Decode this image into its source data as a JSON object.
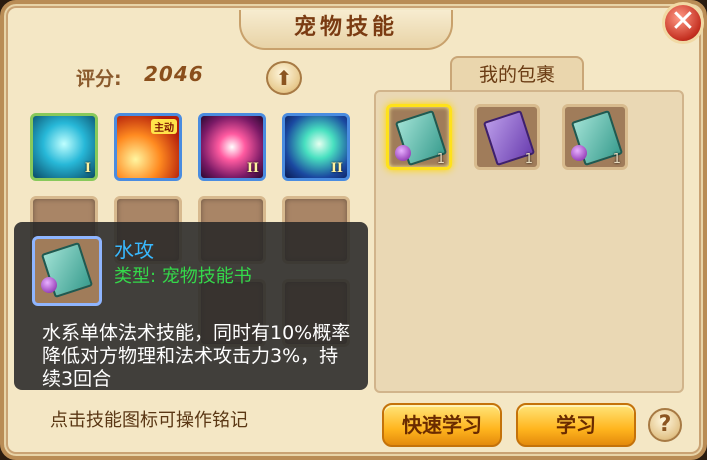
{
  "window": {
    "title": "宠物技能",
    "close_glyph": "✕"
  },
  "score": {
    "label": "评分:",
    "value": "2046"
  },
  "upgrade": {
    "icon": "up-arrow-icon",
    "glyph": "⬆"
  },
  "skills": [
    {
      "name": "water-ghost-skill",
      "level": "I",
      "color": "#27b8d8"
    },
    {
      "name": "fire-burst-skill",
      "badge": "主动",
      "color": "#ff8a20"
    },
    {
      "name": "crimson-star-skill",
      "level": "II",
      "color": "#ff5aa0"
    },
    {
      "name": "lightning-slash-skill",
      "level": "II",
      "color": "#48e0c0"
    }
  ],
  "bag": {
    "tab_label": "我的包裹",
    "items": [
      {
        "icon": "skill-book-icon",
        "count": "1",
        "selected": true
      },
      {
        "icon": "purple-chest-book-icon",
        "count": "1",
        "selected": false
      },
      {
        "icon": "skill-book-icon",
        "count": "1",
        "selected": false
      }
    ]
  },
  "tooltip": {
    "name": "水攻",
    "type": "类型: 宠物技能书",
    "description": "水系单体法术技能，同时有10%概率降低对方物理和法术攻击力3%，持续3回合",
    "icon": "skill-book-icon"
  },
  "hint": "点击技能图标可操作铭记",
  "buttons": {
    "quick_learn": "快速学习",
    "learn": "学习",
    "help_glyph": "?"
  },
  "colors": {
    "tooltip_name": "#38b9ff",
    "tooltip_type": "#34d84a",
    "button": "#ffb51e"
  }
}
